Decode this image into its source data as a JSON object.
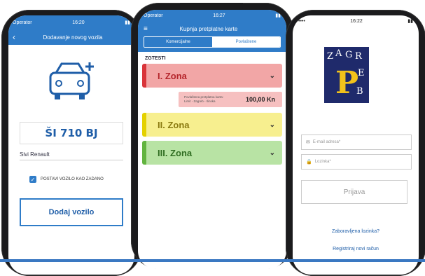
{
  "left": {
    "status_carrier": "Operator",
    "status_time": "16:20",
    "back_icon": "chevron-left-icon",
    "title": "Dodavanje novog vozila",
    "car_icon": "car-add-icon",
    "plate": "ŠI 710 BJ",
    "car_name": "Sivi Renault",
    "checkbox_label": "POSTAVI VOZILO KAO ZADANO",
    "add_button": "Dodaj vozilo"
  },
  "middle": {
    "status_carrier": "Operator",
    "status_time": "16:27",
    "menu_icon": "hamburger-icon",
    "title": "Kupnja pretplatne karte",
    "tabs": [
      "Komercijalne",
      "Povlaštene"
    ],
    "section": "ZGTESTI",
    "zones": [
      {
        "label": "I. Zona",
        "color": "#f2a6a6"
      },
      {
        "label": "II. Zona",
        "color": "#f7ef8f"
      },
      {
        "label": "III. Zona",
        "color": "#b8e3a4"
      }
    ],
    "note": {
      "text1": "Povlaštena pretplatna karta:",
      "text2": "Limit - Zagreb - Ilinska",
      "price": "100,00 Kn"
    }
  },
  "right": {
    "status_time": "16:22",
    "logo_letters": [
      "Z",
      "A",
      "G",
      "R",
      "E",
      "B"
    ],
    "logo_big": "P",
    "email_placeholder": "E-mail adresa*",
    "password_placeholder": "Lozinka*",
    "login_button": "Prijava",
    "forgot_link": "Zaboravljena lozinka?",
    "register_link": "Registriraj novi račun"
  },
  "colors": {
    "primary": "#2f7cc8",
    "red_zone": "#d9343a",
    "yellow_zone": "#e4d100",
    "green_zone": "#62b43f"
  }
}
